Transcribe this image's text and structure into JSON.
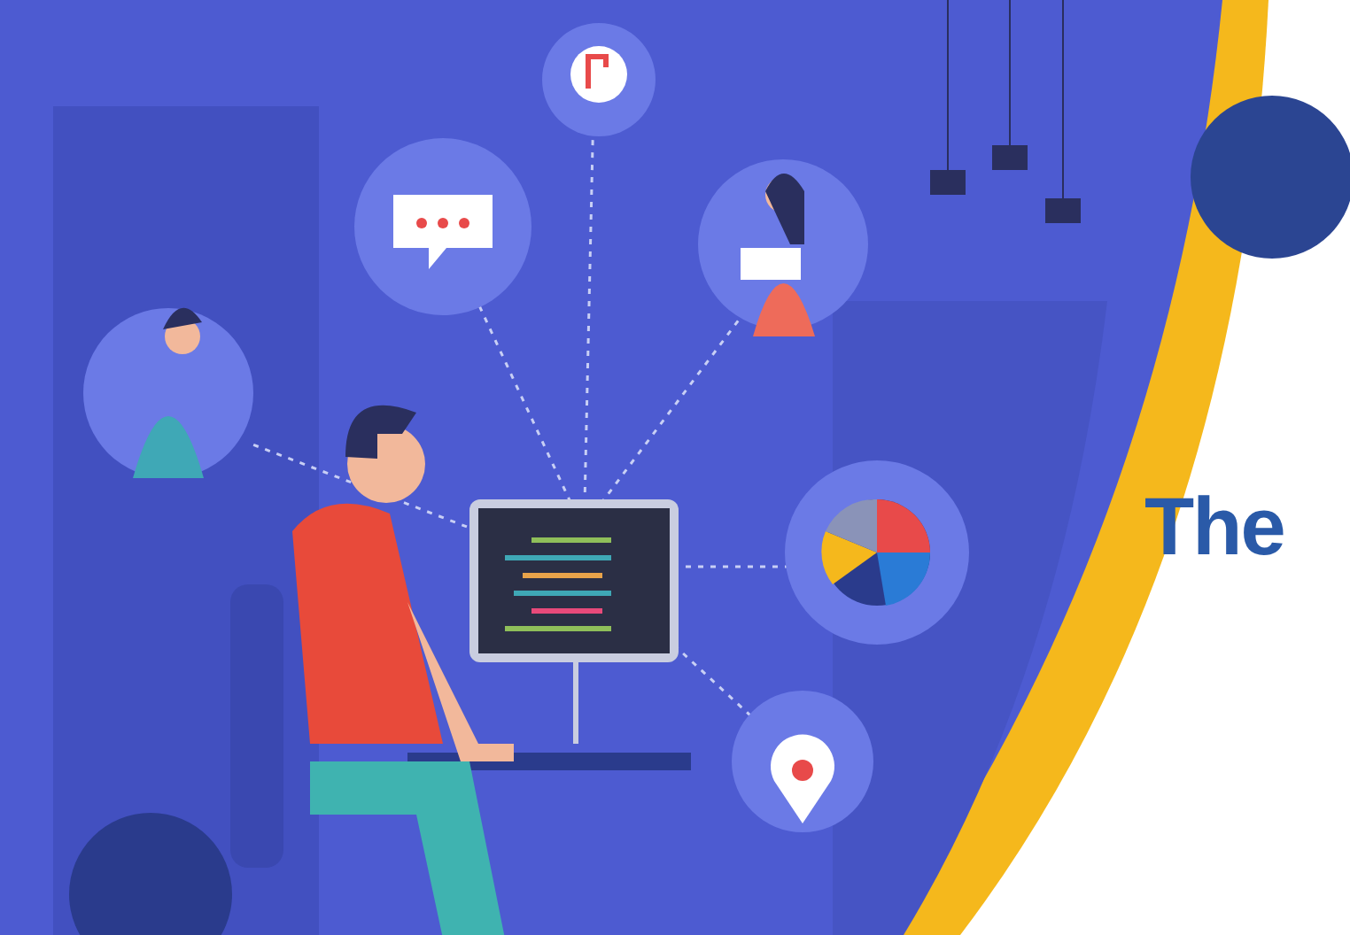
{
  "hero": {
    "heading": "The"
  }
}
